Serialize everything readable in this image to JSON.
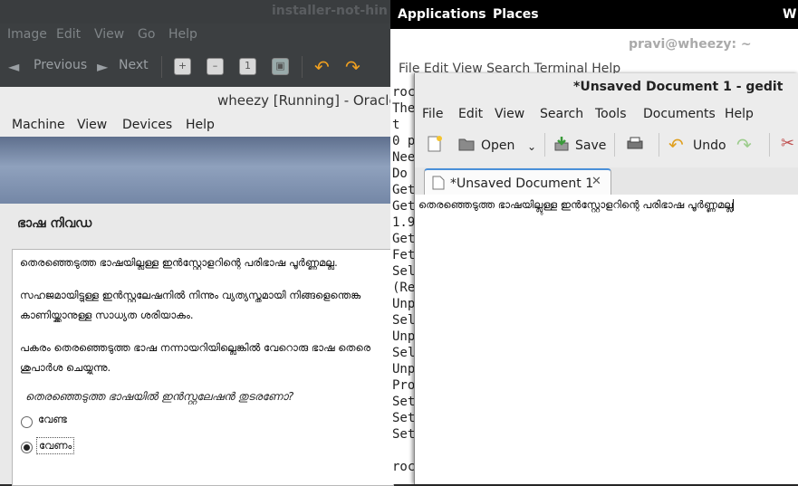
{
  "viewer": {
    "title": "installer-not-hin",
    "menu": [
      "Image",
      "Edit",
      "View",
      "Go",
      "Help"
    ],
    "prev_label": "Previous",
    "next_label": "Next"
  },
  "vbox": {
    "title": "wheezy [Running] - Oracle",
    "menu": [
      "Machine",
      "View",
      "Devices",
      "Help"
    ],
    "heading": "ഭാഷ നിവഡ",
    "paragraphs": [
      "തെരഞ്ഞെടുത്ത ഭാഷയില്ലുള്ള ഇന്‍സ്റ്റോളറിന്റെ പരിഭാഷ പൂര്‍ണ്ണമല്ല.",
      "സഹജമായിട്ടുള്ള ഇന്‍സ്റ്റലേഷനില്‍ നിന്നും വ്യത്യസ്തമായി നിങ്ങളെന്തെങ്ക",
      "കാണിയ്ക്കാനുള്ള സാധ്യത ശരിയാകം.",
      "പകരം തെരഞ്ഞെടുത്ത ഭാഷ നന്നായറിയില്ലെങ്കില്‍ വേറൊരു ഭാഷ തെരെ",
      "ശുപാര്‍ശ ചെയ്യുന്നു."
    ],
    "question": "തെരഞ്ഞെടുത്ത ഭാഷയില്‍ ഇന്‍സ്റ്റലേഷന്‍ തുടരണോ?",
    "options": [
      {
        "label": "വേണ്ട",
        "selected": false
      },
      {
        "label": "വേണം",
        "selected": true
      }
    ]
  },
  "top_panel": {
    "applications": "Applications",
    "places": "Places",
    "clock_partial": "W"
  },
  "terminal": {
    "title": "pravi@wheezy: ~",
    "menu": "File  Edit  View  Search  Terminal  Help",
    "lines": [
      "roc",
      "The",
      "  t",
      "0 p",
      "Nee",
      "Do ",
      "Get",
      "Get",
      "1.9",
      "Get",
      "Fet",
      "Sel",
      "(Re",
      "Unp",
      "Sel",
      "Unp",
      "Sel",
      "Unp",
      "Pro",
      "Set",
      "Set",
      "Set",
      "",
      "roc"
    ]
  },
  "gedit": {
    "title": "*Unsaved Document 1 - gedit",
    "menu": [
      "File",
      "Edit",
      "View",
      "Search",
      "Tools",
      "Documents",
      "Help"
    ],
    "toolbar": {
      "open": "Open",
      "save": "Save",
      "undo": "Undo"
    },
    "tab_label": "*Unsaved Document 1",
    "content": "തെരഞ്ഞെടുത്ത ഭാഷയില്ലുള്ള ഇന്‍സ്റ്റോളറിന്റെ പരിഭാഷ പൂര്‍ണ്ണമല്ല"
  }
}
